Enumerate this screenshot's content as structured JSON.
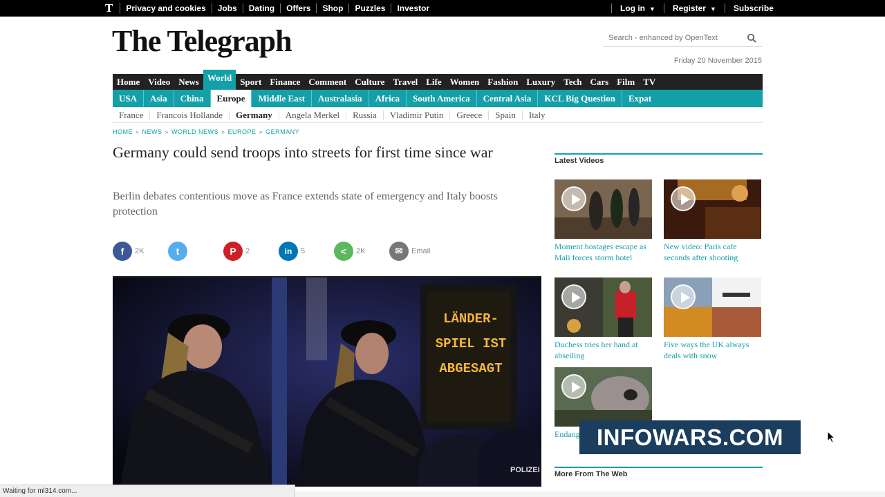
{
  "topbar": {
    "logo": "T",
    "links": [
      "Privacy and cookies",
      "Jobs",
      "Dating",
      "Offers",
      "Shop",
      "Puzzles",
      "Investor"
    ],
    "right": [
      {
        "label": "Log in",
        "caret": "▼"
      },
      {
        "label": "Register",
        "caret": "▼"
      },
      {
        "label": "Subscribe",
        "caret": ""
      }
    ]
  },
  "masthead": {
    "title": "The Telegraph"
  },
  "search": {
    "placeholder": "Search - enhanced by OpenText"
  },
  "date": "Friday 20 November 2015",
  "nav_primary": [
    "Home",
    "Video",
    "News",
    "World",
    "Sport",
    "Finance",
    "Comment",
    "Culture",
    "Travel",
    "Life",
    "Women",
    "Fashion",
    "Luxury",
    "Tech",
    "Cars",
    "Film",
    "TV"
  ],
  "nav_primary_active": "World",
  "nav_secondary": [
    "USA",
    "Asia",
    "China",
    "Europe",
    "Middle East",
    "Australasia",
    "Africa",
    "South America",
    "Central Asia",
    "KCL Big Question",
    "Expat"
  ],
  "nav_secondary_active": "Europe",
  "nav_tertiary": [
    "France",
    "Francois Hollande",
    "Germany",
    "Angela Merkel",
    "Russia",
    "Vladimir Putin",
    "Greece",
    "Spain",
    "Italy"
  ],
  "nav_tertiary_active": "Germany",
  "breadcrumbs": [
    "HOME",
    "NEWS",
    "WORLD NEWS",
    "EUROPE",
    "GERMANY"
  ],
  "breadcrumb_sep": "»",
  "article": {
    "headline": "Germany could send troops into streets for first time since war",
    "standfirst": "Berlin debates contentious move as France extends state of emergency and Italy boosts protection",
    "image_sign": [
      "LÄNDER-",
      "SPIEL IST",
      "ABGESAGT"
    ]
  },
  "share": {
    "facebook": {
      "icon": "f",
      "count": "2K",
      "color": "#3b5998"
    },
    "twitter": {
      "icon": "t",
      "count": "",
      "color": "#55acee"
    },
    "pinterest": {
      "icon": "P",
      "count": "2",
      "color": "#cb2027"
    },
    "linkedin": {
      "icon": "in",
      "count": "5",
      "color": "#0077b5"
    },
    "share": {
      "icon": "<",
      "count": "2K",
      "color": "#5cb85c"
    },
    "email": {
      "icon": "✉",
      "label": "Email",
      "color": "#777777"
    }
  },
  "latest_videos": {
    "title": "Latest Videos",
    "items": [
      {
        "caption": "Moment hostages escape as Mali forces storm hotel"
      },
      {
        "caption": "New video: Paris cafe seconds after shooting"
      },
      {
        "caption": "Duchess tries her hand at abseiling"
      },
      {
        "caption": "Five ways the UK always deals with snow"
      },
      {
        "caption": "Endangered hippo"
      }
    ]
  },
  "more_from_web": "More From The Web",
  "overlay_banner": "INFOWARS.COM",
  "status_bar": "Waiting for ml314.com...",
  "colors": {
    "accent": "#14a0a8",
    "nav_dark": "#222222",
    "banner": "#1b3e5e"
  }
}
